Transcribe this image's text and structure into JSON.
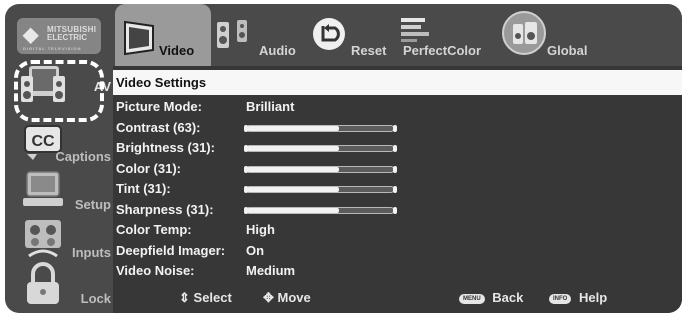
{
  "logo": {
    "brand_line1": "MITSUBISHI",
    "brand_line2": "ELECTRIC",
    "tagline": "DIGITAL TELEVISION"
  },
  "sidebar": {
    "items": [
      {
        "label": "AV",
        "icon": "speakers-tv-icon",
        "active": true
      },
      {
        "label": "Captions",
        "icon": "cc-icon"
      },
      {
        "label": "Setup",
        "icon": "monitor-setup-icon"
      },
      {
        "label": "Inputs",
        "icon": "inputs-icon"
      },
      {
        "label": "Lock",
        "icon": "padlock-icon"
      }
    ]
  },
  "tabs": [
    {
      "label": "Video",
      "icon": "tv-icon",
      "active": true
    },
    {
      "label": "Audio",
      "icon": "speaker-icon"
    },
    {
      "label": "Reset",
      "icon": "reset-arrow-icon"
    },
    {
      "label": "PerfectColor",
      "icon": "color-bars-icon"
    },
    {
      "label": "Global",
      "icon": "globe-icon"
    }
  ],
  "section": {
    "title": "Video Settings"
  },
  "settings": [
    {
      "name": "Picture Mode:",
      "value": "Brilliant"
    },
    {
      "name": "Contrast (63):",
      "slider": 0.63
    },
    {
      "name": "Brightness (31):",
      "slider": 0.63
    },
    {
      "name": "Color (31):",
      "slider": 0.63
    },
    {
      "name": "Tint (31):",
      "slider": 0.63
    },
    {
      "name": "Sharpness (31):",
      "slider": 0.63
    },
    {
      "name": "Color Temp:",
      "value": "High"
    },
    {
      "name": "Deepfield Imager:",
      "value": "On"
    },
    {
      "name": "Video Noise:",
      "value": "Medium"
    }
  ],
  "footer": {
    "select_label": "Select",
    "move_label": "Move",
    "menu_key": "MENU",
    "back_label": "Back",
    "info_key": "INFO",
    "help_label": "Help"
  },
  "colors": {
    "background": "#4a4a4a",
    "panel": "#373737",
    "section_bar": "#f7f7f7",
    "active_tab": "#9a9a9a",
    "highlight_outline": "#ffffff"
  }
}
